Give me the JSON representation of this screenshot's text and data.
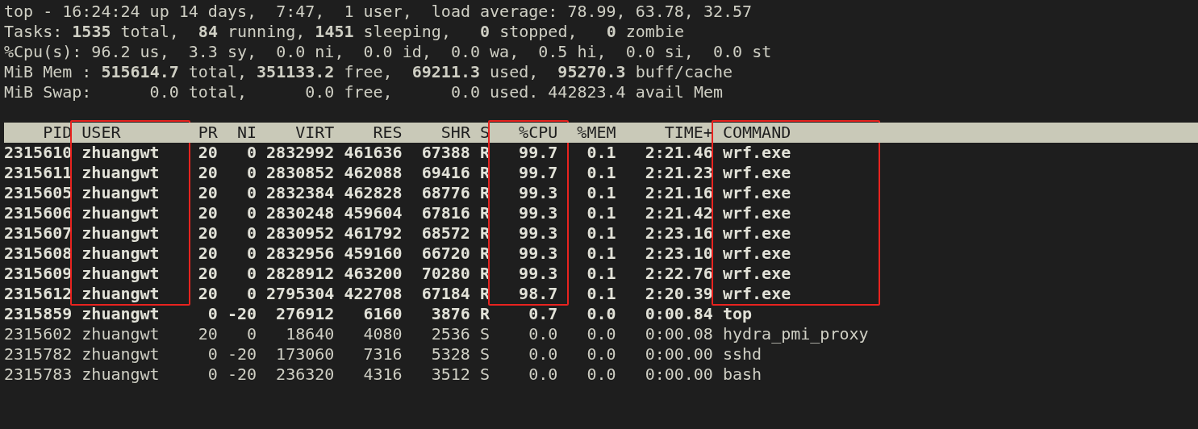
{
  "summary": [
    "top - 16:24:24 up 14 days,  7:47,  1 user,  load average: 78.99, 63.78, 32.57",
    "Tasks: **1535** total,  **84** running, **1451** sleeping,   **0** stopped,   **0** zombie",
    "%Cpu(s): 96.2 us,  3.3 sy,  0.0 ni,  0.0 id,  0.0 wa,  0.5 hi,  0.0 si,  0.0 st",
    "MiB Mem : **515614.7** total, **351133.2** free,  **69211.3** used,  **95270.3** buff/cache",
    "MiB Swap:      0.0 total,      0.0 free,      0.0 used. 442823.4 avail Mem"
  ],
  "table": {
    "columns": [
      {
        "label": "PID",
        "boxed": false
      },
      {
        "label": "USER",
        "boxed": true
      },
      {
        "label": "PR",
        "boxed": false
      },
      {
        "label": "NI",
        "boxed": false
      },
      {
        "label": "VIRT",
        "boxed": false
      },
      {
        "label": "RES",
        "boxed": false
      },
      {
        "label": "SHR",
        "boxed": false
      },
      {
        "label": "S",
        "boxed": false
      },
      {
        "label": "%CPU",
        "boxed": true
      },
      {
        "label": "%MEM",
        "boxed": false
      },
      {
        "label": "TIME+",
        "boxed": false
      },
      {
        "label": "COMMAND",
        "boxed": true
      }
    ],
    "rows": [
      {
        "cells": [
          "2315610",
          "zhuangwt",
          "20",
          "0",
          "2832992",
          "461636",
          "67388",
          "R",
          "99.7",
          "0.1",
          "2:21.46",
          "wrf.exe"
        ],
        "bold": true,
        "boxed": true
      },
      {
        "cells": [
          "2315611",
          "zhuangwt",
          "20",
          "0",
          "2830852",
          "462088",
          "69416",
          "R",
          "99.7",
          "0.1",
          "2:21.23",
          "wrf.exe"
        ],
        "bold": true,
        "boxed": true
      },
      {
        "cells": [
          "2315605",
          "zhuangwt",
          "20",
          "0",
          "2832384",
          "462828",
          "68776",
          "R",
          "99.3",
          "0.1",
          "2:21.16",
          "wrf.exe"
        ],
        "bold": true,
        "boxed": true
      },
      {
        "cells": [
          "2315606",
          "zhuangwt",
          "20",
          "0",
          "2830248",
          "459604",
          "67816",
          "R",
          "99.3",
          "0.1",
          "2:21.42",
          "wrf.exe"
        ],
        "bold": true,
        "boxed": true
      },
      {
        "cells": [
          "2315607",
          "zhuangwt",
          "20",
          "0",
          "2830952",
          "461792",
          "68572",
          "R",
          "99.3",
          "0.1",
          "2:23.16",
          "wrf.exe"
        ],
        "bold": true,
        "boxed": true
      },
      {
        "cells": [
          "2315608",
          "zhuangwt",
          "20",
          "0",
          "2832956",
          "459160",
          "66720",
          "R",
          "99.3",
          "0.1",
          "2:23.10",
          "wrf.exe"
        ],
        "bold": true,
        "boxed": true
      },
      {
        "cells": [
          "2315609",
          "zhuangwt",
          "20",
          "0",
          "2828912",
          "463200",
          "70280",
          "R",
          "99.3",
          "0.1",
          "2:22.76",
          "wrf.exe"
        ],
        "bold": true,
        "boxed": true
      },
      {
        "cells": [
          "2315612",
          "zhuangwt",
          "20",
          "0",
          "2795304",
          "422708",
          "67184",
          "R",
          "98.7",
          "0.1",
          "2:20.39",
          "wrf.exe"
        ],
        "bold": true,
        "boxed": true
      },
      {
        "cells": [
          "2315859",
          "zhuangwt",
          "0",
          "-20",
          "276912",
          "6160",
          "3876",
          "R",
          "0.7",
          "0.0",
          "0:00.84",
          "top"
        ],
        "bold": true,
        "boxed": false
      },
      {
        "cells": [
          "2315602",
          "zhuangwt",
          "20",
          "0",
          "18640",
          "4080",
          "2536",
          "S",
          "0.0",
          "0.0",
          "0:00.08",
          "hydra_pmi_proxy"
        ],
        "bold": false,
        "boxed": false
      },
      {
        "cells": [
          "2315782",
          "zhuangwt",
          "0",
          "-20",
          "173060",
          "7316",
          "5328",
          "S",
          "0.0",
          "0.0",
          "0:00.00",
          "sshd"
        ],
        "bold": false,
        "boxed": false
      },
      {
        "cells": [
          "2315783",
          "zhuangwt",
          "0",
          "-20",
          "236320",
          "4316",
          "3512",
          "S",
          "0.0",
          "0.0",
          "0:00.00",
          "bash"
        ],
        "bold": false,
        "boxed": false
      }
    ]
  }
}
